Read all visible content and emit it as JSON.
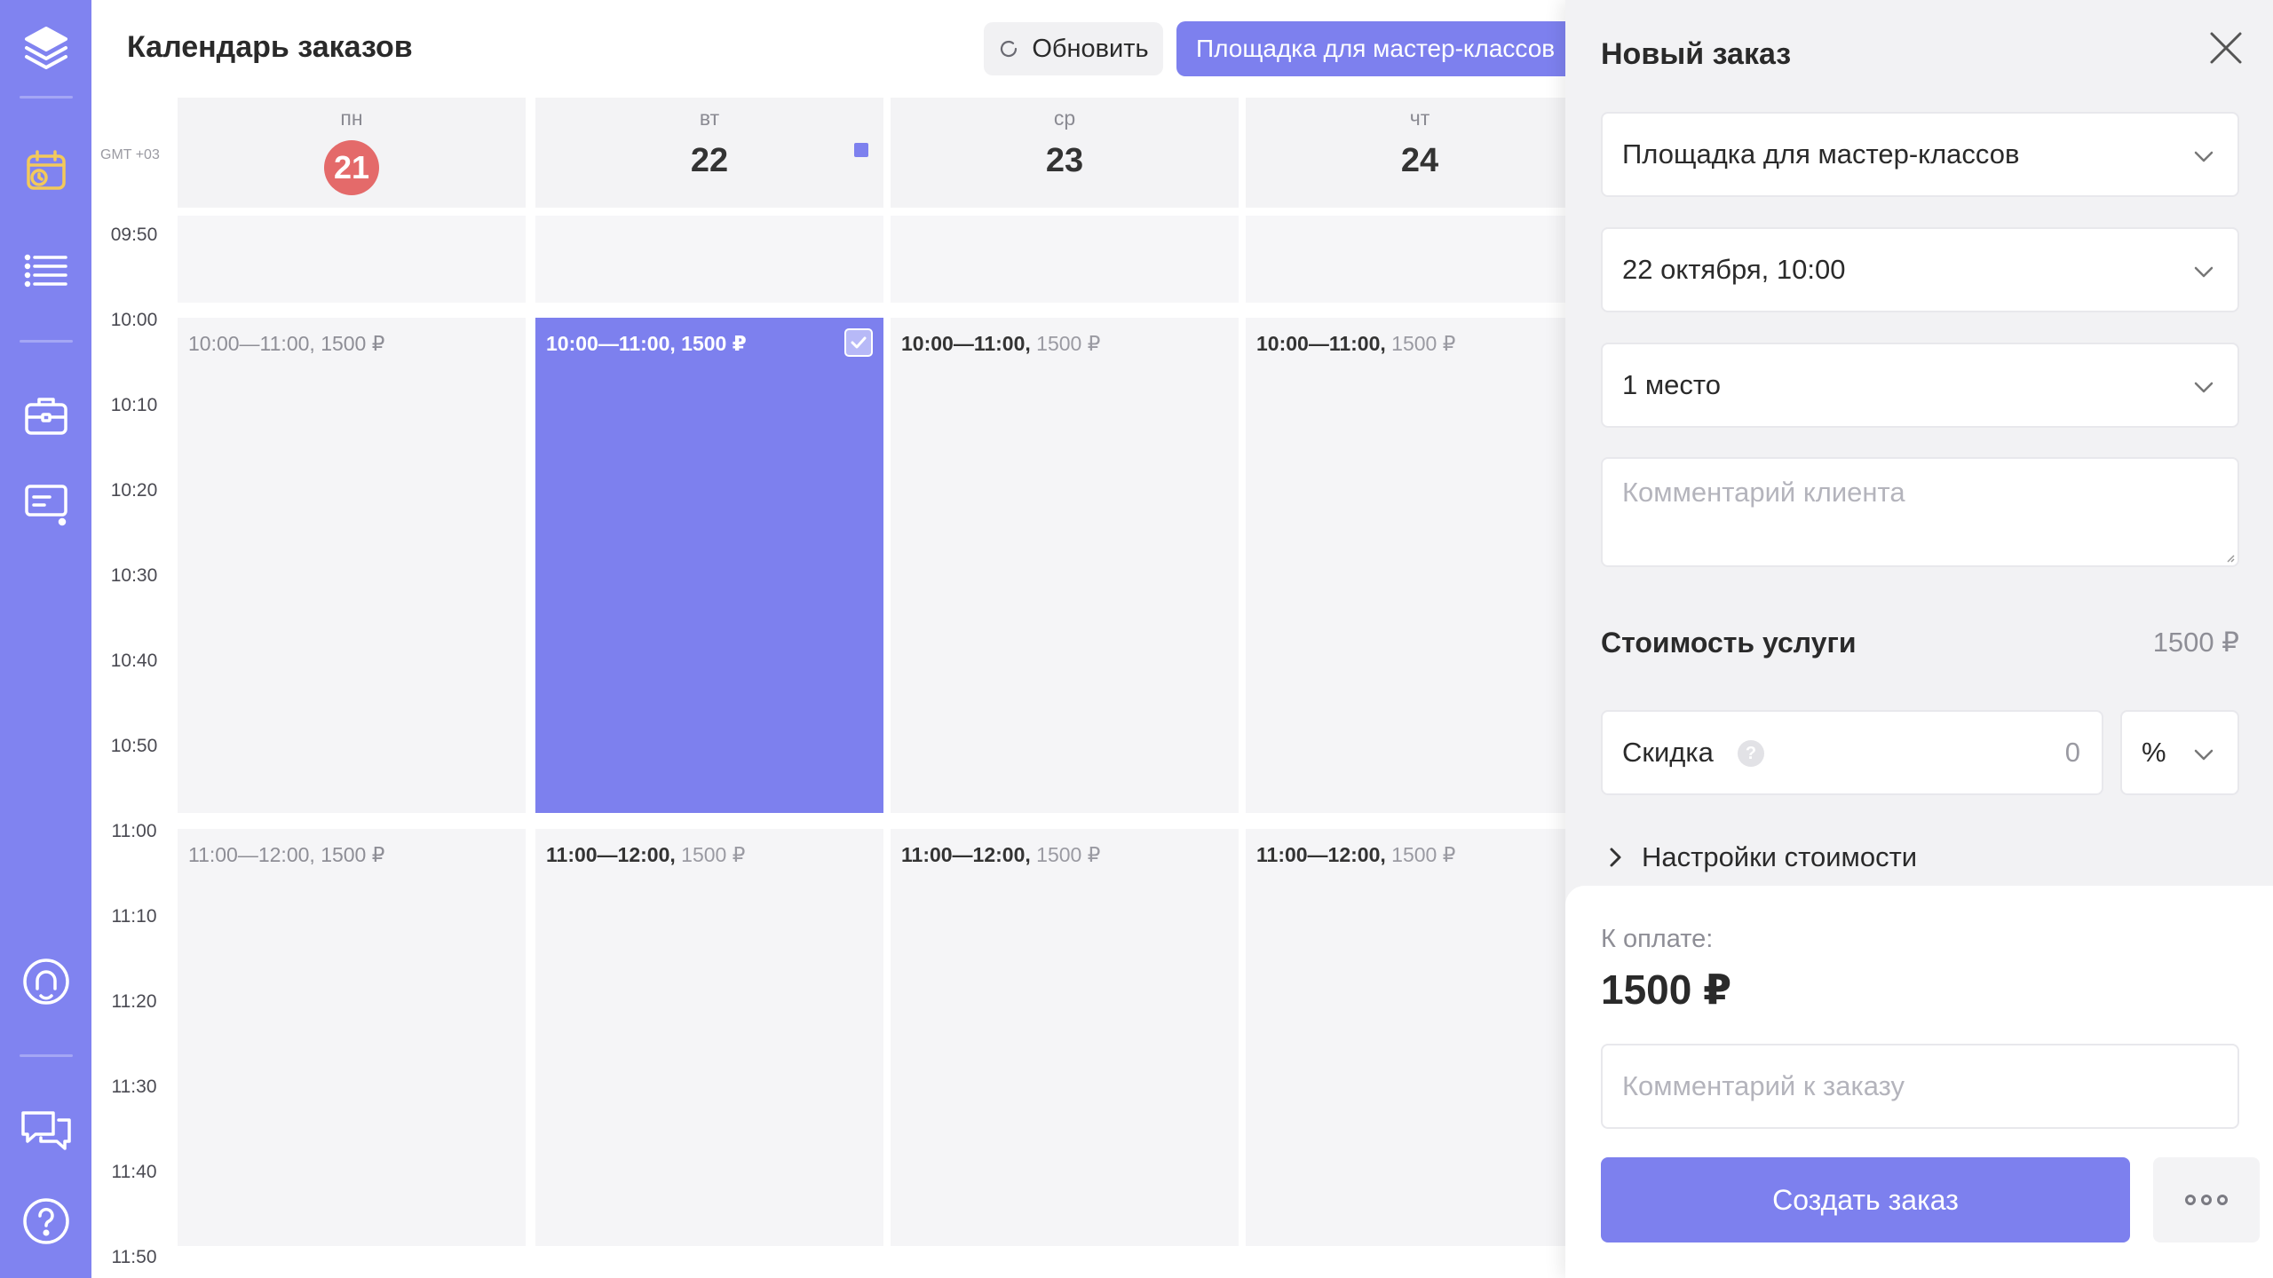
{
  "header": {
    "title": "Календарь заказов",
    "refresh_label": "Обновить",
    "venue_label": "Площадка для мастер-классов"
  },
  "calendar": {
    "timezone": "GMT +03",
    "days": [
      {
        "name": "пн",
        "number": "21",
        "today": true
      },
      {
        "name": "вт",
        "number": "22",
        "marked": true
      },
      {
        "name": "ср",
        "number": "23"
      },
      {
        "name": "чт",
        "number": "24"
      }
    ],
    "times": [
      "09:50",
      "10:00",
      "10:10",
      "10:20",
      "10:30",
      "10:40",
      "10:50",
      "11:00",
      "11:10",
      "11:20",
      "11:30",
      "11:40",
      "11:50"
    ],
    "slot_rows": [
      {
        "time": "10:00—11:00,",
        "price": "1500 ₽",
        "cells": [
          {
            "state": "muted"
          },
          {
            "state": "selected"
          },
          {
            "state": "normal"
          },
          {
            "state": "normal"
          }
        ]
      },
      {
        "time": "11:00—12:00,",
        "price": "1500 ₽",
        "cells": [
          {
            "state": "muted"
          },
          {
            "state": "normal"
          },
          {
            "state": "normal"
          },
          {
            "state": "normal"
          }
        ]
      }
    ]
  },
  "panel": {
    "title": "Новый заказ",
    "venue_select": "Площадка для мастер-классов",
    "date_select": "22 октября, 10:00",
    "seats_select": "1 место",
    "client_comment_placeholder": "Комментарий клиента",
    "cost_label": "Стоимость услуги",
    "cost_value": "1500 ₽",
    "discount_label": "Скидка",
    "discount_help": "?",
    "discount_value": "0",
    "discount_unit": "%",
    "settings_label": "Настройки стоимости",
    "pay_label": "К оплате:",
    "pay_amount": "1500 ₽",
    "order_comment_placeholder": "Комментарий к заказу",
    "create_label": "Создать заказ"
  },
  "colors": {
    "accent": "#7d80ee",
    "sidebar": "#8083f0",
    "today": "#e46a6a",
    "calendar_icon": "#f3c95a"
  },
  "icons": {
    "sidebar": [
      "logo-icon",
      "calendar-icon",
      "list-icon",
      "briefcase-icon",
      "message-icon",
      "support-icon",
      "chat-icon",
      "help-icon"
    ]
  }
}
